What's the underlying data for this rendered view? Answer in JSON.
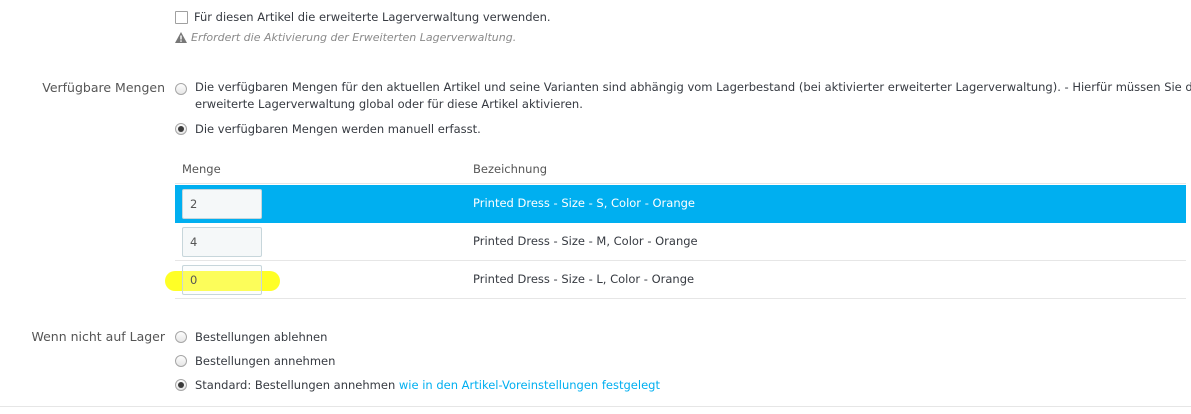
{
  "advanced_stock": {
    "checkbox_label": "Für diesen Artikel die erweiterte Lagerverwaltung verwenden.",
    "hint": "Erfordert die Aktivierung der Erweiterten Lagerverwaltung.",
    "hint_icon": "warning-icon"
  },
  "available_qty": {
    "label": "Verfügbare Mengen",
    "options": [
      {
        "line1": "Die verfügbaren Mengen für den aktuellen Artikel und seine Varianten sind abhängig vom Lagerbestand (bei aktivierter erweiterter Lagerverwaltung).  - Hierfür müssen Sie die",
        "line2": "erweiterte Lagerverwaltung global oder für diese Artikel aktivieren.",
        "checked": false
      },
      {
        "line1": "Die verfügbaren Mengen werden manuell erfasst.",
        "checked": true
      }
    ]
  },
  "table": {
    "headers": {
      "qty": "Menge",
      "name": "Bezeichnung"
    },
    "rows": [
      {
        "qty": "2",
        "name": "Printed Dress - Size - S, Color - Orange",
        "selected": true
      },
      {
        "qty": "4",
        "name": "Printed Dress - Size - M, Color - Orange",
        "selected": false
      },
      {
        "qty": "0",
        "name": "Printed Dress - Size - L, Color - Orange",
        "selected": false,
        "highlighted": true
      }
    ]
  },
  "out_of_stock": {
    "label": "Wenn nicht auf Lager",
    "options": [
      {
        "text": "Bestellungen ablehnen",
        "checked": false
      },
      {
        "text": "Bestellungen annehmen",
        "checked": false
      },
      {
        "text": "Standard: Bestellungen annehmen ",
        "link": "wie in den Artikel-Voreinstellungen festgelegt",
        "checked": true
      }
    ]
  },
  "colors": {
    "accent": "#00aff0",
    "highlight": "#ffff1a"
  }
}
